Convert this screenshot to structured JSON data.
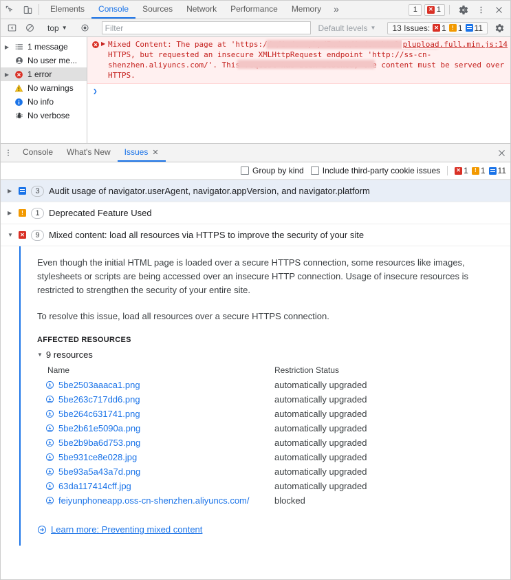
{
  "main_tabbar": {
    "inspect_icon": "inspect-cursor-icon",
    "device_icon": "device-toolbar-icon",
    "tabs": [
      {
        "label": "Elements",
        "active": false
      },
      {
        "label": "Console",
        "active": true
      },
      {
        "label": "Sources",
        "active": false
      },
      {
        "label": "Network",
        "active": false
      },
      {
        "label": "Performance",
        "active": false
      },
      {
        "label": "Memory",
        "active": false
      }
    ],
    "more_tabs_label": "»",
    "error_badge_count": "1",
    "issue_badge_count": "1",
    "settings_icon": "gear-icon",
    "kebab_icon": "more-options-icon",
    "close_icon": "close-icon"
  },
  "filter_bar": {
    "sidebar_toggle_icon": "show-console-sidebar-icon",
    "clear_icon": "clear-console-icon",
    "context_label": "top",
    "eye_icon": "live-expression-icon",
    "filter_placeholder": "Filter",
    "filter_value": "",
    "levels_label": "Default levels",
    "issues_label": "13 Issues:",
    "issues_error_count": "1",
    "issues_warning_count": "1",
    "issues_info_count": "11",
    "settings_icon": "console-settings-icon"
  },
  "console_sidebar": {
    "items": [
      {
        "label": "1 message",
        "icon": "list-icon",
        "expandable": true,
        "selected": false
      },
      {
        "label": "No user me...",
        "icon": "user-message-icon",
        "expandable": false,
        "selected": false
      },
      {
        "label": "1 error",
        "icon": "error-circle-icon",
        "expandable": true,
        "selected": true
      },
      {
        "label": "No warnings",
        "icon": "warning-triangle-icon",
        "expandable": false,
        "selected": false
      },
      {
        "label": "No info",
        "icon": "info-circle-icon",
        "expandable": false,
        "selected": false
      },
      {
        "label": "No verbose",
        "icon": "verbose-bug-icon",
        "expandable": false,
        "selected": false
      }
    ]
  },
  "console_message": {
    "icon": "error-circle-icon",
    "expand_arrow": "▶",
    "text_part1": "Mixed Content: The page at 'https://",
    "text_part2": "m/index.php/Index/index.html' was loaded over HTTPS, but requested an insecure XMLHttpRequest endpoint 'http://",
    "text_part3": "ss-cn-shenzhen.aliyuncs.com/'. This request has been blocked; the content must be served over HTTPS.",
    "source_link": "plupload.full.min.js:14",
    "prompt_chevron": "❯"
  },
  "drawer": {
    "kebab_icon": "drawer-more-options-icon",
    "tabs": [
      {
        "label": "Console",
        "active": false,
        "closable": false
      },
      {
        "label": "What's New",
        "active": false,
        "closable": false
      },
      {
        "label": "Issues",
        "active": true,
        "closable": true
      }
    ],
    "tab_close_label": "✕",
    "close_icon": "close-drawer-icon",
    "toolbar": {
      "group_by_kind_label": "Group by kind",
      "group_by_kind_checked": false,
      "third_party_label": "Include third-party cookie issues",
      "third_party_checked": false,
      "error_count": "1",
      "warning_count": "1",
      "info_count": "11"
    }
  },
  "issues": [
    {
      "kind": "info",
      "count": "3",
      "title": "Audit usage of navigator.userAgent, navigator.appVersion, and navigator.platform",
      "expanded": false,
      "highlight": true
    },
    {
      "kind": "warning",
      "count": "1",
      "title": "Deprecated Feature Used",
      "expanded": false,
      "highlight": false
    },
    {
      "kind": "error",
      "count": "9",
      "title": "Mixed content: load all resources via HTTPS to improve the security of your site",
      "expanded": true,
      "highlight": false
    }
  ],
  "issue_detail": {
    "paragraph1": "Even though the initial HTML page is loaded over a secure HTTPS connection, some resources like images, stylesheets or scripts are being accessed over an insecure HTTP connection. Usage of insecure resources is restricted to strengthen the security of your entire site.",
    "paragraph2": "To resolve this issue, load all resources over a secure HTTPS connection.",
    "affected_resources_heading": "AFFECTED RESOURCES",
    "resources_toggle_label": "9 resources",
    "columns": {
      "name": "Name",
      "status": "Restriction Status"
    },
    "resources": [
      {
        "name": "5be2503aaaca1.png",
        "status": "automatically upgraded",
        "icon": "resource-link-icon"
      },
      {
        "name": "5be263c717dd6.png",
        "status": "automatically upgraded",
        "icon": "resource-link-icon"
      },
      {
        "name": "5be264c631741.png",
        "status": "automatically upgraded",
        "icon": "resource-link-icon"
      },
      {
        "name": "5be2b61e5090a.png",
        "status": "automatically upgraded",
        "icon": "resource-link-icon"
      },
      {
        "name": "5be2b9ba6d753.png",
        "status": "automatically upgraded",
        "icon": "resource-link-icon"
      },
      {
        "name": "5be931ce8e028.jpg",
        "status": "automatically upgraded",
        "icon": "resource-link-icon"
      },
      {
        "name": "5be93a5a43a7d.png",
        "status": "automatically upgraded",
        "icon": "resource-link-icon"
      },
      {
        "name": "63da117414cff.jpg",
        "status": "automatically upgraded",
        "icon": "resource-link-icon"
      },
      {
        "name": "feiyunphoneapp.oss-cn-shenzhen.aliyuncs.com/",
        "status": "blocked",
        "icon": "resource-link-icon"
      }
    ],
    "learn_more_label": "Learn more: Preventing mixed content",
    "learn_more_icon": "arrow-right-circle-icon"
  },
  "colors": {
    "accent": "#1a73e8",
    "error": "#d93025",
    "warning": "#f29900",
    "console_error_bg": "#fff0f0",
    "console_error_text": "#c5221f",
    "row_highlight": "#e8eef7"
  }
}
